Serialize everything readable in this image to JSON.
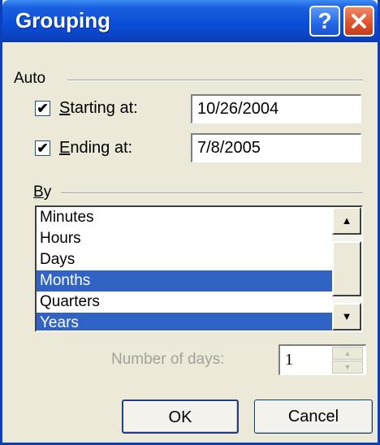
{
  "window": {
    "title": "Grouping",
    "help_glyph": "?",
    "close_icon": "close-icon"
  },
  "auto": {
    "label": "Auto",
    "starting": {
      "checked_mark": "✔",
      "label_accel": "S",
      "label_rest": "tarting at:",
      "value": "10/26/2004"
    },
    "ending": {
      "checked_mark": "✔",
      "label_accel": "E",
      "label_rest": "nding at:",
      "value": "7/8/2005"
    }
  },
  "by": {
    "label_accel": "B",
    "label_rest": "y",
    "items": [
      {
        "label": "Minutes",
        "selected": false
      },
      {
        "label": "Hours",
        "selected": false
      },
      {
        "label": "Days",
        "selected": false
      },
      {
        "label": "Months",
        "selected": true
      },
      {
        "label": "Quarters",
        "selected": false
      },
      {
        "label": "Years",
        "selected": true
      }
    ],
    "scroll_up_glyph": "▲",
    "scroll_down_glyph": "▼"
  },
  "days": {
    "label": "Number of days:",
    "value": "1",
    "up_glyph": "▲",
    "down_glyph": "▼"
  },
  "buttons": {
    "ok": "OK",
    "cancel": "Cancel"
  },
  "colors": {
    "titlebar": "#0a4fd8",
    "selection": "#3163c5",
    "face": "#ece9d8"
  }
}
